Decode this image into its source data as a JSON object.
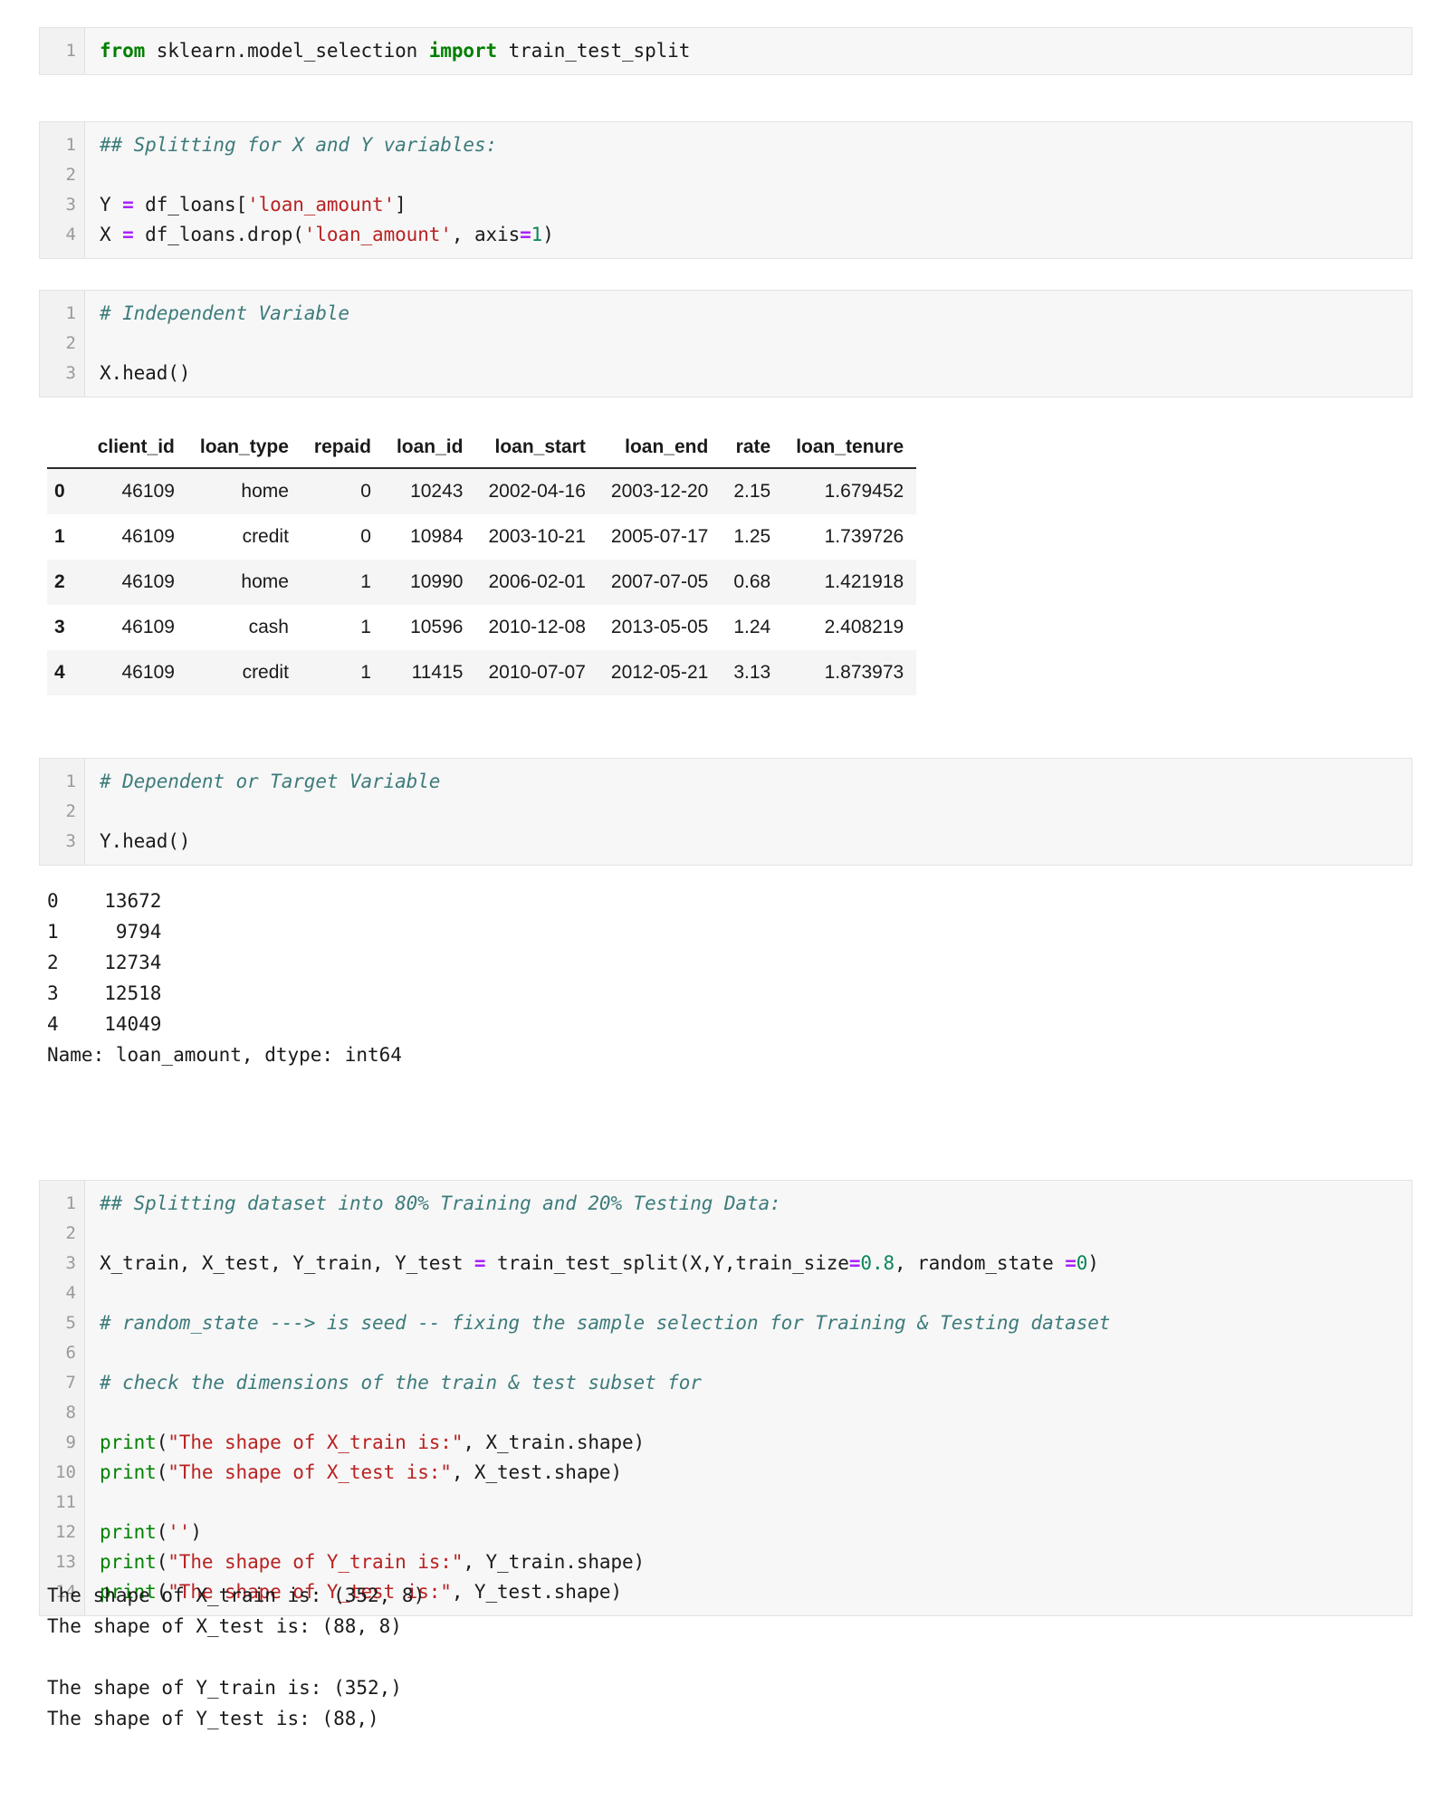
{
  "notebook": {
    "cells": [
      {
        "id": "cell-import",
        "line_numbers": [
          "1"
        ],
        "lines": [
          [
            {
              "t": "from ",
              "c": "kw"
            },
            {
              "t": "sklearn.model_selection ",
              "c": "plain"
            },
            {
              "t": "import ",
              "c": "kw"
            },
            {
              "t": "train_test_split",
              "c": "plain"
            }
          ]
        ]
      },
      {
        "id": "cell-split-xy",
        "line_numbers": [
          "1",
          "2",
          "3",
          "4"
        ],
        "lines": [
          [
            {
              "t": "## Splitting for X and Y variables:",
              "c": "cmt"
            }
          ],
          [
            {
              "t": "",
              "c": "plain"
            }
          ],
          [
            {
              "t": "Y ",
              "c": "plain"
            },
            {
              "t": "=",
              "c": "op"
            },
            {
              "t": " df_loans[",
              "c": "plain"
            },
            {
              "t": "'loan_amount'",
              "c": "str"
            },
            {
              "t": "]",
              "c": "plain"
            }
          ],
          [
            {
              "t": "X ",
              "c": "plain"
            },
            {
              "t": "=",
              "c": "op"
            },
            {
              "t": " df_loans.drop(",
              "c": "plain"
            },
            {
              "t": "'loan_amount'",
              "c": "str"
            },
            {
              "t": ", axis",
              "c": "plain"
            },
            {
              "t": "=",
              "c": "op"
            },
            {
              "t": "1",
              "c": "num"
            },
            {
              "t": ")",
              "c": "plain"
            }
          ]
        ]
      },
      {
        "id": "cell-independent",
        "line_numbers": [
          "1",
          "2",
          "3"
        ],
        "lines": [
          [
            {
              "t": "# Independent Variable",
              "c": "cmt"
            }
          ],
          [
            {
              "t": "",
              "c": "plain"
            }
          ],
          [
            {
              "t": "X.head()",
              "c": "plain"
            }
          ]
        ]
      },
      {
        "id": "cell-dependent",
        "line_numbers": [
          "1",
          "2",
          "3"
        ],
        "lines": [
          [
            {
              "t": "# Dependent or Target Variable",
              "c": "cmt"
            }
          ],
          [
            {
              "t": "",
              "c": "plain"
            }
          ],
          [
            {
              "t": "Y.head()",
              "c": "plain"
            }
          ]
        ]
      },
      {
        "id": "cell-train-test",
        "line_numbers": [
          "1",
          "2",
          "3",
          "4",
          "5",
          "6",
          "7",
          "8",
          "9",
          "10",
          "11",
          "12",
          "13",
          "14"
        ],
        "lines": [
          [
            {
              "t": "## Splitting dataset into 80% Training and 20% Testing Data:",
              "c": "cmt"
            }
          ],
          [
            {
              "t": "",
              "c": "plain"
            }
          ],
          [
            {
              "t": "X_train, X_test, Y_train, Y_test ",
              "c": "plain"
            },
            {
              "t": "=",
              "c": "op"
            },
            {
              "t": " train_test_split(X,Y,train_size",
              "c": "plain"
            },
            {
              "t": "=",
              "c": "op"
            },
            {
              "t": "0.8",
              "c": "num"
            },
            {
              "t": ", random_state ",
              "c": "plain"
            },
            {
              "t": "=",
              "c": "op"
            },
            {
              "t": "0",
              "c": "num"
            },
            {
              "t": ")",
              "c": "plain"
            }
          ],
          [
            {
              "t": "",
              "c": "plain"
            }
          ],
          [
            {
              "t": "# random_state ---> is seed -- fixing the sample selection for Training & Testing dataset",
              "c": "cmt"
            }
          ],
          [
            {
              "t": "",
              "c": "plain"
            }
          ],
          [
            {
              "t": "# check the dimensions of the train & test subset for",
              "c": "cmt"
            }
          ],
          [
            {
              "t": "",
              "c": "plain"
            }
          ],
          [
            {
              "t": "print",
              "c": "builtin"
            },
            {
              "t": "(",
              "c": "plain"
            },
            {
              "t": "\"The shape of X_train is:\"",
              "c": "str"
            },
            {
              "t": ", X_train.shape)",
              "c": "plain"
            }
          ],
          [
            {
              "t": "print",
              "c": "builtin"
            },
            {
              "t": "(",
              "c": "plain"
            },
            {
              "t": "\"The shape of X_test is:\"",
              "c": "str"
            },
            {
              "t": ", X_test.shape)",
              "c": "plain"
            }
          ],
          [
            {
              "t": "",
              "c": "plain"
            }
          ],
          [
            {
              "t": "print",
              "c": "builtin"
            },
            {
              "t": "(",
              "c": "plain"
            },
            {
              "t": "''",
              "c": "str"
            },
            {
              "t": ")",
              "c": "plain"
            }
          ],
          [
            {
              "t": "print",
              "c": "builtin"
            },
            {
              "t": "(",
              "c": "plain"
            },
            {
              "t": "\"The shape of Y_train is:\"",
              "c": "str"
            },
            {
              "t": ", Y_train.shape)",
              "c": "plain"
            }
          ],
          [
            {
              "t": "print",
              "c": "builtin"
            },
            {
              "t": "(",
              "c": "plain"
            },
            {
              "t": "\"The shape of Y_test is:\"",
              "c": "str"
            },
            {
              "t": ", Y_test.shape)",
              "c": "plain"
            }
          ]
        ]
      }
    ],
    "outputs": {
      "y_head": "0    13672\n1     9794\n2    12734\n3    12518\n4    14049\nName: loan_amount, dtype: int64",
      "shapes": "The shape of X_train is: (352, 8)\nThe shape of X_test is: (88, 8)\n\nThe shape of Y_train is: (352,)\nThe shape of Y_test is: (88,)"
    },
    "dataframe": {
      "index_header": "",
      "columns": [
        "client_id",
        "loan_type",
        "repaid",
        "loan_id",
        "loan_start",
        "loan_end",
        "rate",
        "loan_tenure"
      ],
      "index": [
        "0",
        "1",
        "2",
        "3",
        "4"
      ],
      "rows": [
        [
          "46109",
          "home",
          "0",
          "10243",
          "2002-04-16",
          "2003-12-20",
          "2.15",
          "1.679452"
        ],
        [
          "46109",
          "credit",
          "0",
          "10984",
          "2003-10-21",
          "2005-07-17",
          "1.25",
          "1.739726"
        ],
        [
          "46109",
          "home",
          "1",
          "10990",
          "2006-02-01",
          "2007-07-05",
          "0.68",
          "1.421918"
        ],
        [
          "46109",
          "cash",
          "1",
          "10596",
          "2010-12-08",
          "2013-05-05",
          "1.24",
          "2.408219"
        ],
        [
          "46109",
          "credit",
          "1",
          "11415",
          "2010-07-07",
          "2012-05-21",
          "3.13",
          "1.873973"
        ]
      ]
    }
  }
}
